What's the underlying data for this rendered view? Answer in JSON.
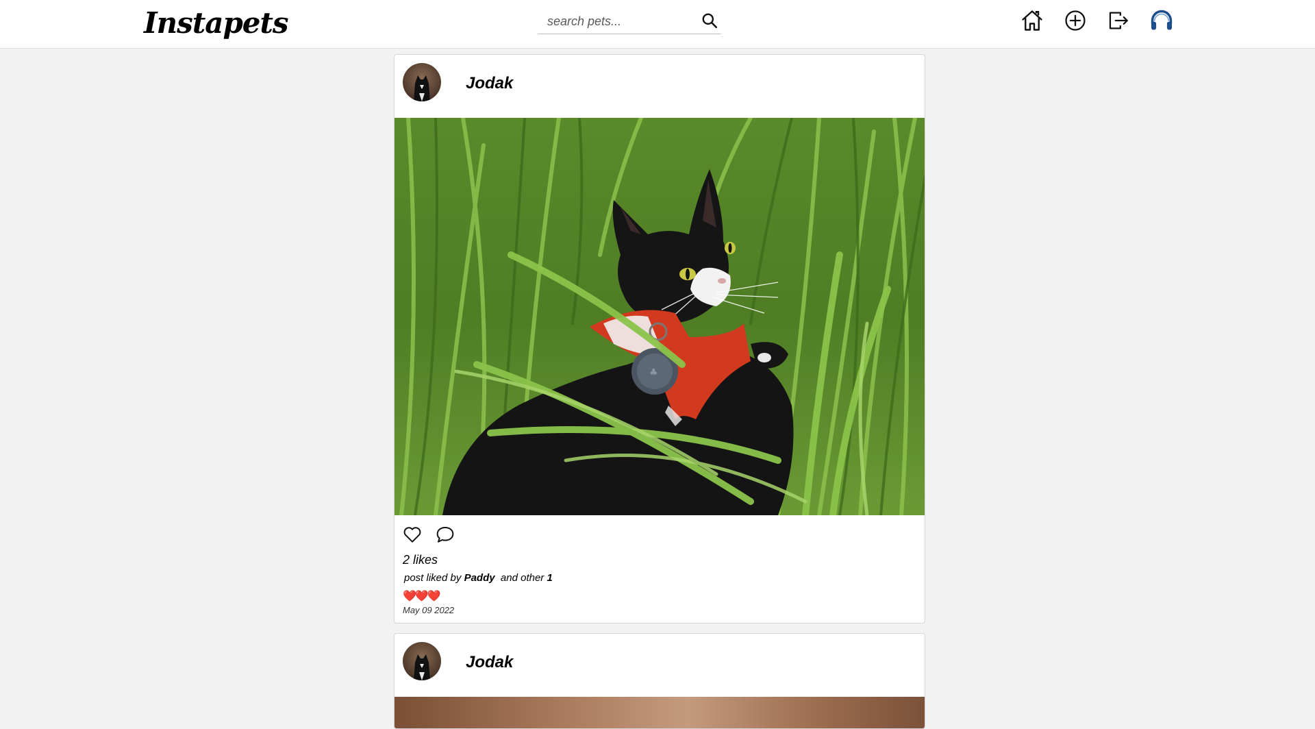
{
  "app": {
    "logo_text": "Instapets"
  },
  "search": {
    "placeholder": "search pets...",
    "value": ""
  },
  "nav": {
    "icons": [
      "home-icon",
      "add-post-icon",
      "logout-icon",
      "support-headset-icon"
    ],
    "accent_color": "#1f4e8c"
  },
  "posts": [
    {
      "username": "Jodak",
      "likes_text": "2 likes",
      "liked_by_prefix": "post liked by",
      "liked_by_user": "Paddy",
      "liked_by_middle": "and other",
      "liked_by_count": "1",
      "caption": "❤️❤️❤️",
      "date": "May 09 2022"
    },
    {
      "username": "Jodak"
    }
  ],
  "colors": {
    "page_background": "#f2f2f2",
    "card_background": "#ffffff",
    "heart_red": "#e0201b"
  }
}
